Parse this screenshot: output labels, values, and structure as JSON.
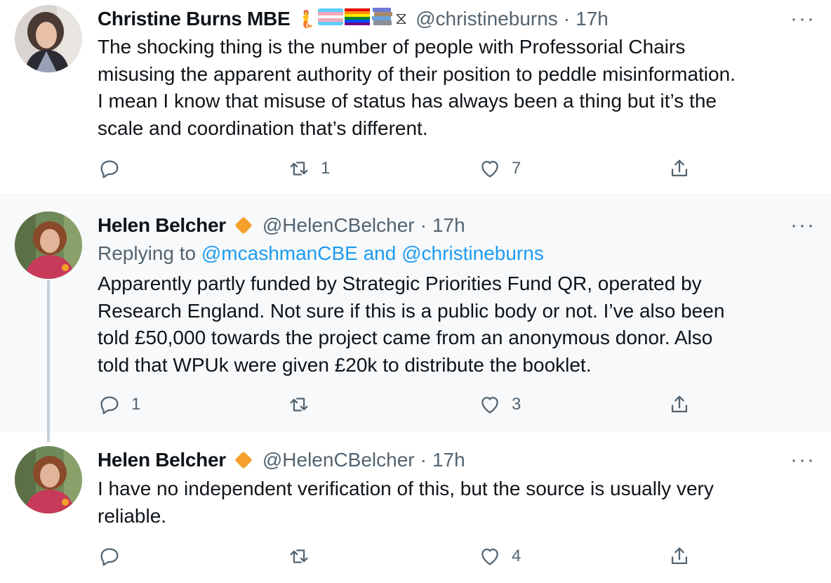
{
  "tweets": [
    {
      "name": "Christine Burns MBE",
      "emojis": [
        "🧜",
        "🏳️‍⚧️",
        "🏳️‍🌈",
        "📚",
        "⧖"
      ],
      "handle": "@christineburns",
      "time": "17h",
      "text": "The shocking thing is the number of people with Professorial Chairs\nmisusing the apparent authority of their position to peddle misinformation.\nI mean I know that misuse of status has always been a thing but it’s the\nscale and coordination that’s different.",
      "replies": "",
      "retweets": "1",
      "likes": "7"
    },
    {
      "name": "Helen Belcher",
      "handle": "@HelenCBelcher",
      "time": "17h",
      "replying_prefix": "Replying to",
      "replying_mention1": "@mcashmanCBE",
      "replying_and": "and",
      "replying_mention2": "@christineburns",
      "text": "Apparently partly funded by Strategic Priorities Fund QR, operated by\nResearch England. Not sure if this is a public body or not. I’ve also been\ntold £50,000 towards the project came from an anonymous donor. Also\ntold that WPUk were given £20k to distribute the booklet.",
      "replies": "1",
      "retweets": "",
      "likes": "3"
    },
    {
      "name": "Helen Belcher",
      "handle": "@HelenCBelcher",
      "time": "17h",
      "text": "I have no independent verification of this, but the source is usually very\nreliable.",
      "replies": "",
      "retweets": "",
      "likes": "4"
    }
  ],
  "separator_dot": "·",
  "more_glyph": "···",
  "colors": {
    "text": "#0f1419",
    "muted": "#536471",
    "link": "#1d9bf0",
    "highlight_bg": "#f7f9fa",
    "verified_diamond": "#f4a02a"
  }
}
